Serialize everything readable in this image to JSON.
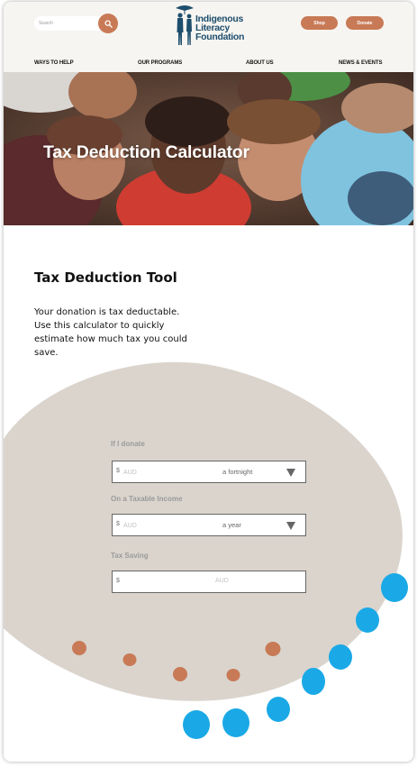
{
  "header": {
    "search_placeholder": "Search",
    "logo_lines": [
      "Indigenous",
      "Literacy",
      "Foundation"
    ],
    "shop_label": "Shop",
    "donate_label": "Donate"
  },
  "nav": {
    "items": [
      "WAYS TO HELP",
      "OUR PROGRAMS",
      "ABOUT US",
      "NEWS & EVENTS"
    ]
  },
  "hero": {
    "title": "Tax Deduction Calculator"
  },
  "intro": {
    "title": "Tax Deduction Tool",
    "text": "Your donation is tax deductable. Use this calculator to quickly estimate how much tax you could save."
  },
  "form": {
    "donate": {
      "label": "If I donate",
      "currency_symbol": "$",
      "placeholder": "AUD",
      "period": "a fortnight"
    },
    "income": {
      "label": "On a Taxable Income",
      "currency_symbol": "$",
      "placeholder": "AUD",
      "period": "a year"
    },
    "saving": {
      "label": "Tax Saving",
      "currency_symbol": "$",
      "unit": "AUD"
    }
  },
  "colors": {
    "accent": "#c87a56",
    "brand_text": "#1d4e6d",
    "header_bg": "#f7f5f1",
    "blob": "#dad4cd",
    "dot_orange": "#c87a56",
    "dot_blue": "#1aa9e6"
  },
  "icons": {
    "search": "search-icon",
    "dropdown": "caret-down-icon"
  }
}
